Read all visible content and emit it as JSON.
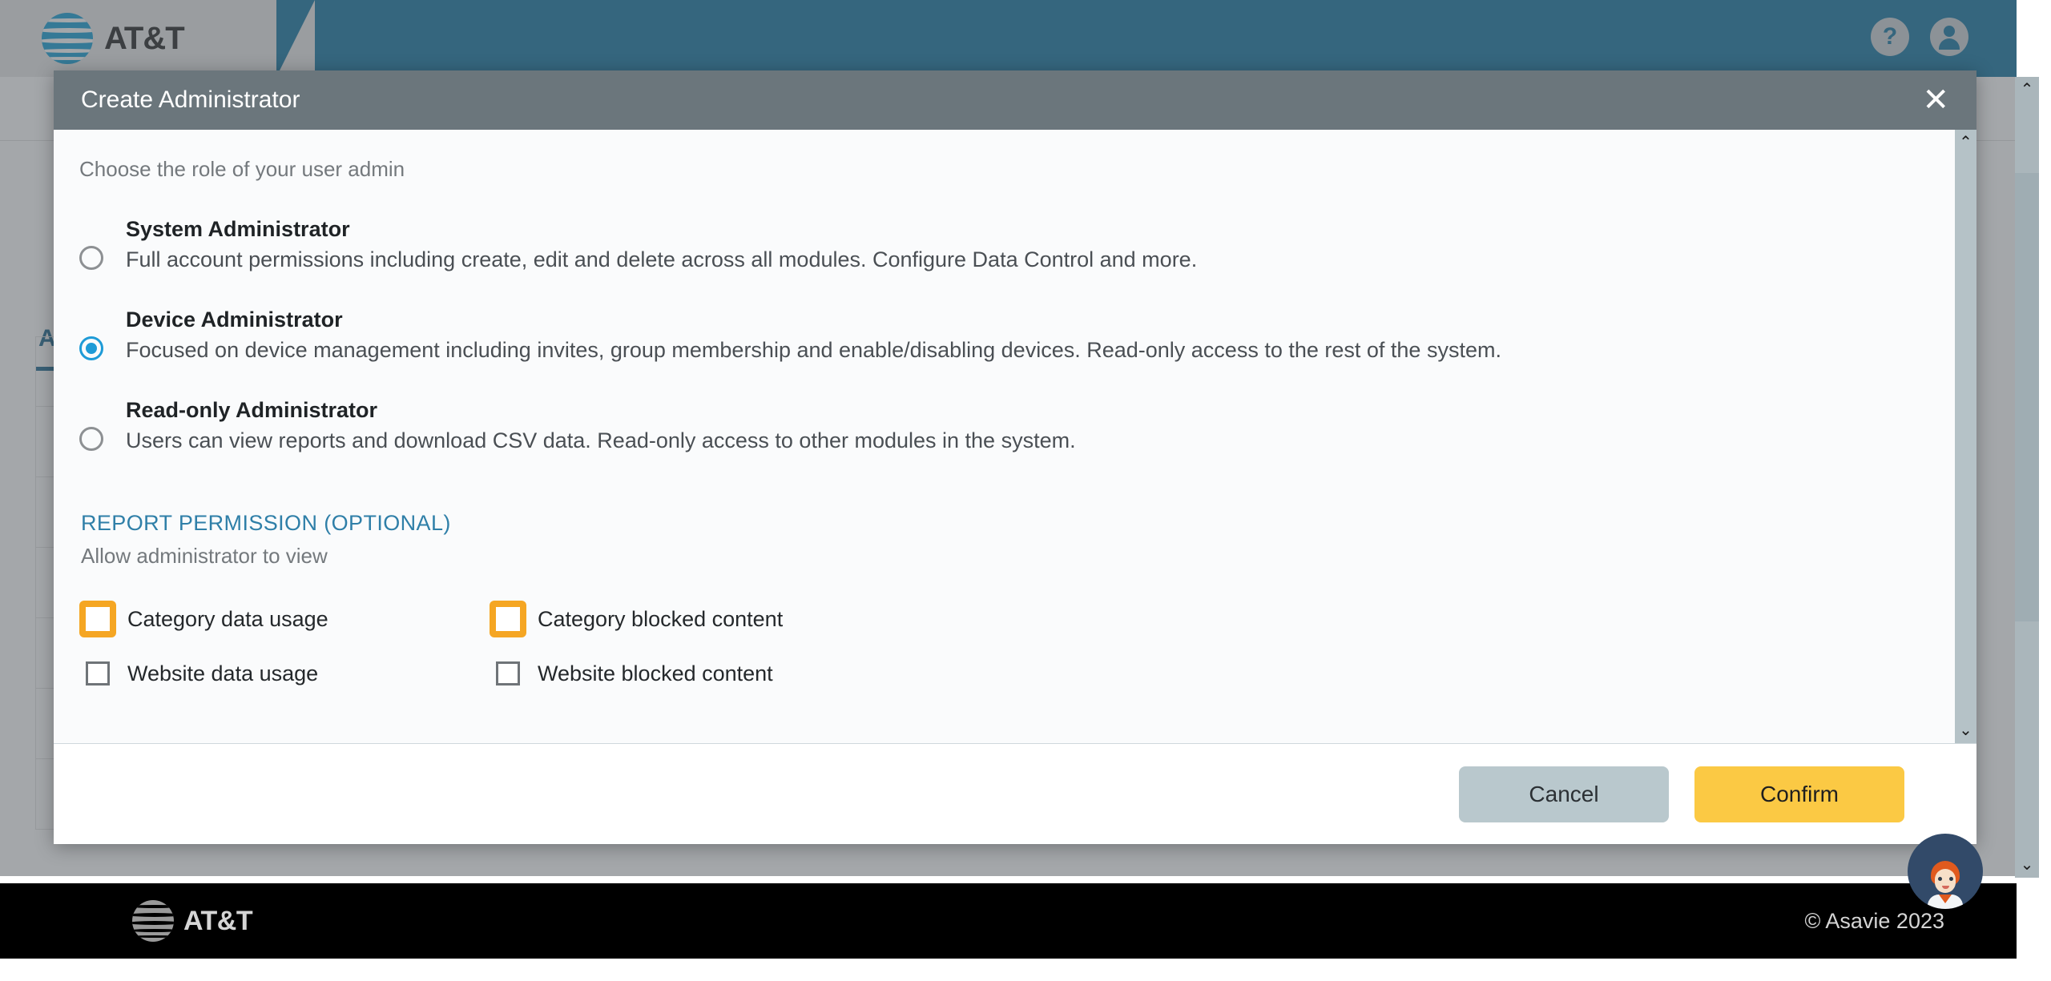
{
  "app": {
    "brand_name": "AT&T",
    "header_color": "#0a6f9e",
    "accent_yellow": "#fbc944",
    "accent_blue": "#1e9bd7"
  },
  "topbar": {
    "help_icon": "question-mark-icon",
    "account_icon": "account-person-icon"
  },
  "background_page": {
    "tab_label": "A",
    "rows_count": 7
  },
  "modal": {
    "title": "Create Administrator",
    "close_label": "✕",
    "helper_text": "Choose the role of your user admin",
    "roles": [
      {
        "name": "System Administrator",
        "description": "Full account permissions including create, edit and delete across all modules. Configure Data Control and more.",
        "selected": false
      },
      {
        "name": "Device Administrator",
        "description": "Focused on device management including invites, group membership and enable/disabling devices. Read-only access to the rest of the system.",
        "selected": true
      },
      {
        "name": "Read-only Administrator",
        "description": "Users can view reports and download CSV data. Read-only access to other modules in the system.",
        "selected": false
      }
    ],
    "report_permission": {
      "section_title": "REPORT PERMISSION (OPTIONAL)",
      "section_subtitle": "Allow administrator to view",
      "checkboxes": [
        {
          "label": "Category data usage",
          "checked": false,
          "highlighted": true
        },
        {
          "label": "Category blocked content",
          "checked": false,
          "highlighted": true
        },
        {
          "label": "Website data usage",
          "checked": false,
          "highlighted": false
        },
        {
          "label": "Website blocked content",
          "checked": false,
          "highlighted": false
        }
      ]
    },
    "footer": {
      "cancel_label": "Cancel",
      "confirm_label": "Confirm"
    },
    "scrollbar": {
      "up_arrow": "⌃",
      "down_arrow": "⌄"
    }
  },
  "page_footer": {
    "brand_name": "AT&T",
    "copyright": "© Asavie 2023"
  },
  "chat_widget": {
    "label": "support-agent-avatar"
  }
}
